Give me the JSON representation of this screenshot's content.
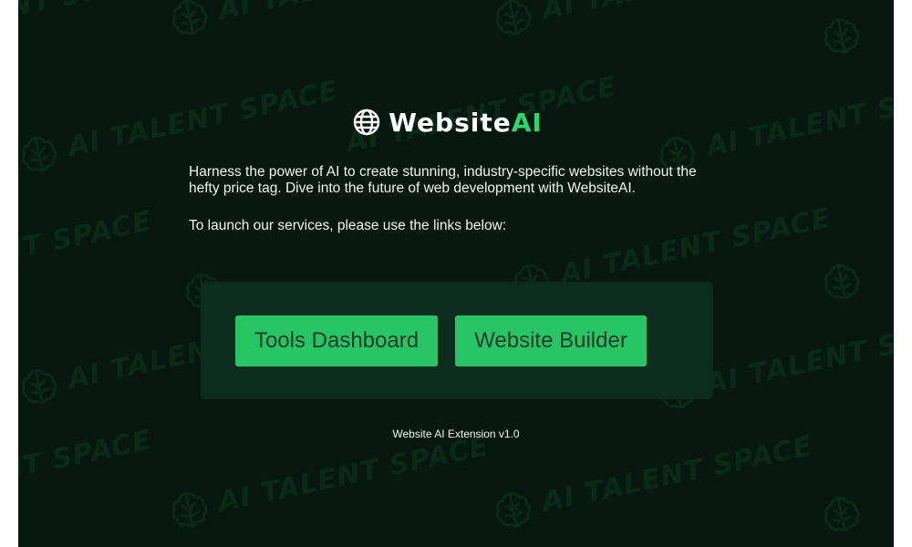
{
  "watermark": {
    "text": "AI TALENT SPACE",
    "fragment_start": "AI TALENT SPA",
    "fragment_end": "NT SPACE",
    "icon": "brain-icon"
  },
  "app": {
    "logo": {
      "icon": "globe-icon",
      "name_main": "Website",
      "name_accent": "AI"
    },
    "intro_text": "Harness the power of AI to create stunning, industry-specific websites without the hefty price tag. Dive into the future of web development with WebsiteAI.",
    "launch_text": "To launch our services, please use the links below:",
    "buttons": {
      "tools_dashboard": "Tools Dashboard",
      "website_builder": "Website Builder"
    },
    "footer_text": "Website AI Extension v1.0"
  },
  "colors": {
    "background": "#071811",
    "panel": "#0c2c1d",
    "accent": "#2bd66d",
    "button": "#28c566",
    "button_text": "#1c3a27",
    "watermark": "#0e3a1c"
  }
}
